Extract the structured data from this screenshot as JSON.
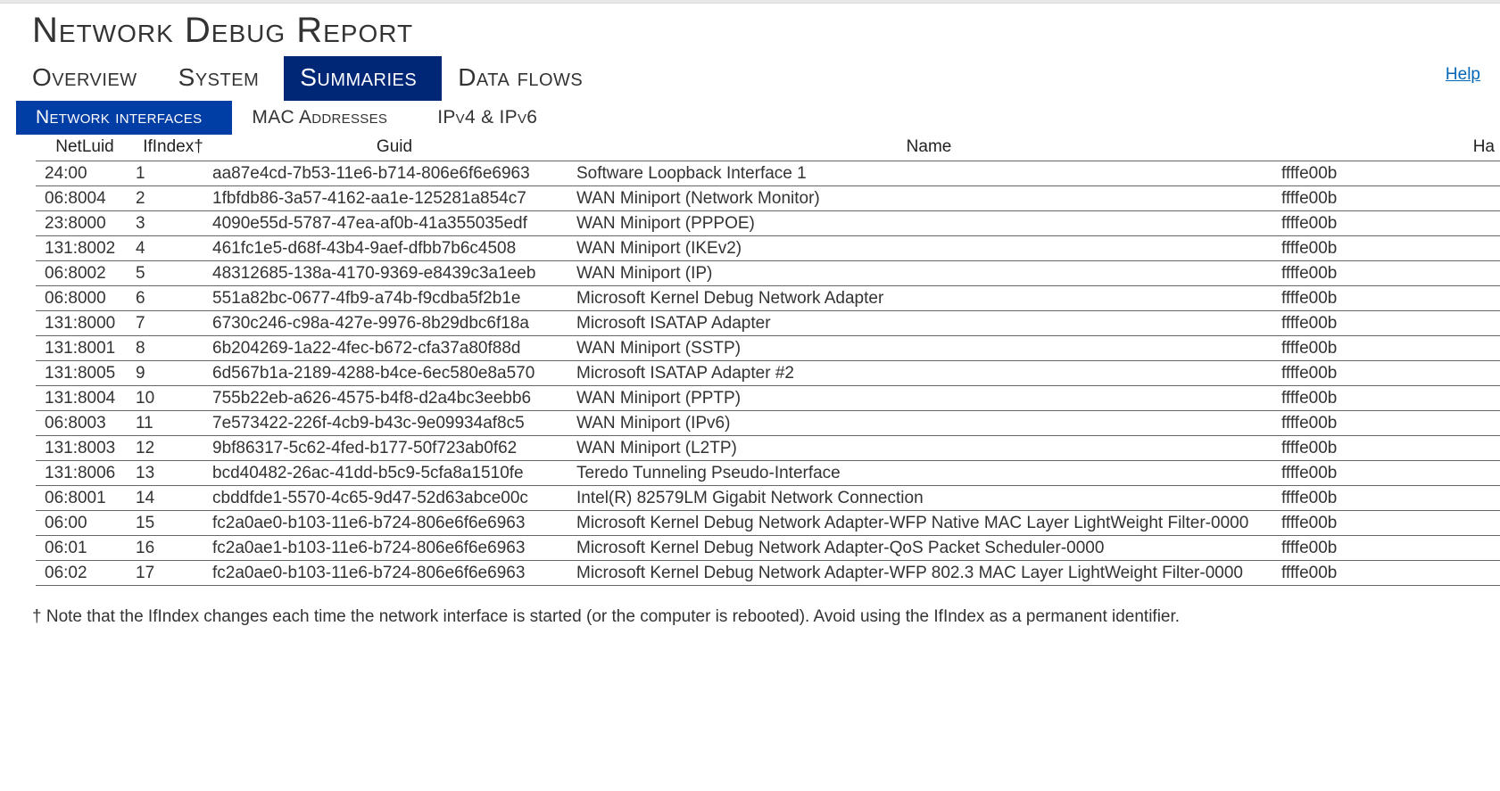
{
  "title": "Network Debug Report",
  "help": "Help",
  "tabs_primary": [
    {
      "label": "Overview",
      "active": false
    },
    {
      "label": "System",
      "active": false
    },
    {
      "label": "Summaries",
      "active": true
    },
    {
      "label": "Data flows",
      "active": false
    }
  ],
  "tabs_secondary": [
    {
      "label": "Network interfaces",
      "active": true
    },
    {
      "label": "MAC Addresses",
      "active": false
    },
    {
      "label": "IPv4 & IPv6",
      "active": false
    }
  ],
  "columns": {
    "netluid": "NetLuid",
    "ifindex": "IfIndex†",
    "guid": "Guid",
    "name": "Name",
    "ha": "Ha"
  },
  "rows": [
    {
      "netluid": "24:00",
      "ifindex": "1",
      "guid": "aa87e4cd-7b53-11e6-b714-806e6f6e6963",
      "name": "Software Loopback Interface 1",
      "ha": "ffffe00b"
    },
    {
      "netluid": "06:8004",
      "ifindex": "2",
      "guid": "1fbfdb86-3a57-4162-aa1e-125281a854c7",
      "name": "WAN Miniport (Network Monitor)",
      "ha": "ffffe00b"
    },
    {
      "netluid": "23:8000",
      "ifindex": "3",
      "guid": "4090e55d-5787-47ea-af0b-41a355035edf",
      "name": "WAN Miniport (PPPOE)",
      "ha": "ffffe00b"
    },
    {
      "netluid": "131:8002",
      "ifindex": "4",
      "guid": "461fc1e5-d68f-43b4-9aef-dfbb7b6c4508",
      "name": "WAN Miniport (IKEv2)",
      "ha": "ffffe00b"
    },
    {
      "netluid": "06:8002",
      "ifindex": "5",
      "guid": "48312685-138a-4170-9369-e8439c3a1eeb",
      "name": "WAN Miniport (IP)",
      "ha": "ffffe00b"
    },
    {
      "netluid": "06:8000",
      "ifindex": "6",
      "guid": "551a82bc-0677-4fb9-a74b-f9cdba5f2b1e",
      "name": "Microsoft Kernel Debug Network Adapter",
      "ha": "ffffe00b"
    },
    {
      "netluid": "131:8000",
      "ifindex": "7",
      "guid": "6730c246-c98a-427e-9976-8b29dbc6f18a",
      "name": "Microsoft ISATAP Adapter",
      "ha": "ffffe00b"
    },
    {
      "netluid": "131:8001",
      "ifindex": "8",
      "guid": "6b204269-1a22-4fec-b672-cfa37a80f88d",
      "name": "WAN Miniport (SSTP)",
      "ha": "ffffe00b"
    },
    {
      "netluid": "131:8005",
      "ifindex": "9",
      "guid": "6d567b1a-2189-4288-b4ce-6ec580e8a570",
      "name": "Microsoft ISATAP Adapter #2",
      "ha": "ffffe00b"
    },
    {
      "netluid": "131:8004",
      "ifindex": "10",
      "guid": "755b22eb-a626-4575-b4f8-d2a4bc3eebb6",
      "name": "WAN Miniport (PPTP)",
      "ha": "ffffe00b"
    },
    {
      "netluid": "06:8003",
      "ifindex": "11",
      "guid": "7e573422-226f-4cb9-b43c-9e09934af8c5",
      "name": "WAN Miniport (IPv6)",
      "ha": "ffffe00b"
    },
    {
      "netluid": "131:8003",
      "ifindex": "12",
      "guid": "9bf86317-5c62-4fed-b177-50f723ab0f62",
      "name": "WAN Miniport (L2TP)",
      "ha": "ffffe00b"
    },
    {
      "netluid": "131:8006",
      "ifindex": "13",
      "guid": "bcd40482-26ac-41dd-b5c9-5cfa8a1510fe",
      "name": "Teredo Tunneling Pseudo-Interface",
      "ha": "ffffe00b"
    },
    {
      "netluid": "06:8001",
      "ifindex": "14",
      "guid": "cbddfde1-5570-4c65-9d47-52d63abce00c",
      "name": "Intel(R) 82579LM Gigabit Network Connection",
      "ha": "ffffe00b"
    },
    {
      "netluid": "06:00",
      "ifindex": "15",
      "guid": "fc2a0ae0-b103-11e6-b724-806e6f6e6963",
      "name": "Microsoft Kernel Debug Network Adapter-WFP Native MAC Layer LightWeight Filter-0000",
      "ha": "ffffe00b"
    },
    {
      "netluid": "06:01",
      "ifindex": "16",
      "guid": "fc2a0ae1-b103-11e6-b724-806e6f6e6963",
      "name": "Microsoft Kernel Debug Network Adapter-QoS Packet Scheduler-0000",
      "ha": "ffffe00b"
    },
    {
      "netluid": "06:02",
      "ifindex": "17",
      "guid": "fc2a0ae0-b103-11e6-b724-806e6f6e6963",
      "name": "Microsoft Kernel Debug Network Adapter-WFP 802.3 MAC Layer LightWeight Filter-0000",
      "ha": "ffffe00b"
    }
  ],
  "footnote": "† Note that the IfIndex changes each time the network interface is started (or the computer is rebooted). Avoid using the IfIndex as a permanent identifier."
}
